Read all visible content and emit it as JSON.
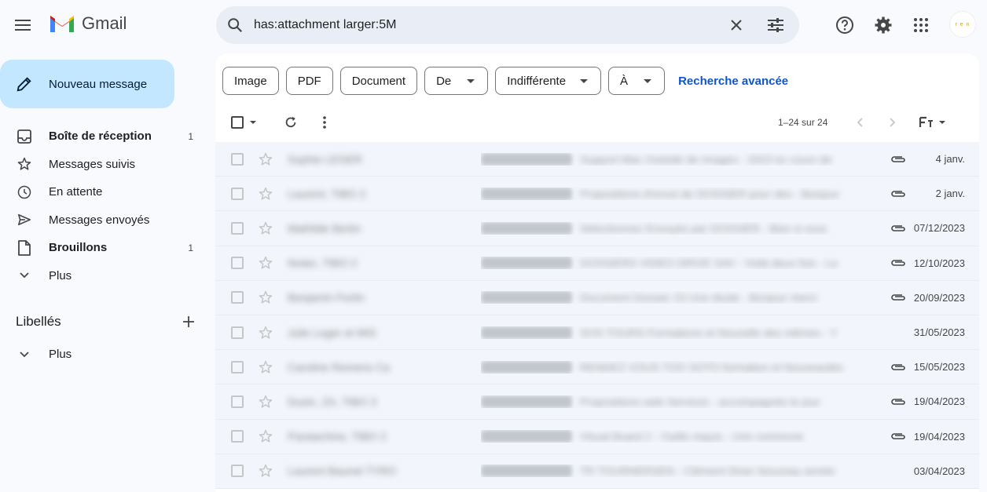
{
  "app": {
    "name": "Gmail"
  },
  "search": {
    "query": "has:attachment larger:5M"
  },
  "avatar": {
    "text": "r e n"
  },
  "compose": {
    "label": "Nouveau message"
  },
  "nav": [
    {
      "label": "Boîte de réception",
      "count": "1",
      "bold": true,
      "icon": "inbox-icon"
    },
    {
      "label": "Messages suivis",
      "count": "",
      "bold": false,
      "icon": "star-icon"
    },
    {
      "label": "En attente",
      "count": "",
      "bold": false,
      "icon": "clock-icon"
    },
    {
      "label": "Messages envoyés",
      "count": "",
      "bold": false,
      "icon": "send-icon"
    },
    {
      "label": "Brouillons",
      "count": "1",
      "bold": true,
      "icon": "draft-icon"
    },
    {
      "label": "Plus",
      "count": "",
      "bold": false,
      "icon": "chevron-down-icon"
    }
  ],
  "labels": {
    "title": "Libellés",
    "more": "Plus"
  },
  "filters": {
    "chips": [
      {
        "label": "Image",
        "dropdown": false
      },
      {
        "label": "PDF",
        "dropdown": false
      },
      {
        "label": "Document",
        "dropdown": false
      },
      {
        "label": "De",
        "dropdown": true
      },
      {
        "label": "Indifférente",
        "dropdown": true
      },
      {
        "label": "À",
        "dropdown": true
      }
    ],
    "advanced": "Recherche avancée"
  },
  "pager": {
    "text": "1–24 sur 24"
  },
  "emails": [
    {
      "sender": "Sophie LEGER",
      "subject": "Support Mac Outside de Images - 2023 ex cours de",
      "date": "4 janv.",
      "attachment": true
    },
    {
      "sender": "Laurent, TIBO 2",
      "subject": "Propositions d'envoi de DOSSIER pour des - Bonjour",
      "date": "2 janv.",
      "attachment": true
    },
    {
      "sender": "Mathilde Bertin",
      "subject": "Sélectionnez Envoyés par DOSSIER - Bien à vous",
      "date": "07/12/2023",
      "attachment": true
    },
    {
      "sender": "Nolan, TIBO 2",
      "subject": "DOSSIERS VIDEO DRIVE SAV - Voilà deux fois - Le",
      "date": "12/10/2023",
      "attachment": true
    },
    {
      "sender": "Benjamin Fortin",
      "subject": "Document Dossier 23 Une étude - Bonjour merci",
      "date": "20/09/2023",
      "attachment": true
    },
    {
      "sender": "Julie Leger et MIS",
      "subject": "SOS TOURS Formations et Nouvelle des mêmes - Y",
      "date": "31/05/2023",
      "attachment": false
    },
    {
      "sender": "Caroline Remens Ca",
      "subject": "RENDEZ VOUS TOO SOTO formation et Nouveautés",
      "date": "15/05/2023",
      "attachment": true
    },
    {
      "sender": "Dusin, ZA, TIBO 3",
      "subject": "Propositions web Services - accompagnés le jour",
      "date": "19/04/2023",
      "attachment": true
    },
    {
      "sender": "Paraiachine, TIBO 2",
      "subject": "Visual Board 2 - Outils requis - Une commune",
      "date": "19/04/2023",
      "attachment": true
    },
    {
      "sender": "Laurent Baunet TYRO",
      "subject": "TR TOURNERSEN - Clément Diner Nouveau année",
      "date": "03/04/2023",
      "attachment": false
    }
  ],
  "colors": {
    "compose_bg": "#c2e7ff",
    "accent": "#0b57d0",
    "row_bg": "#f2f6fc"
  }
}
